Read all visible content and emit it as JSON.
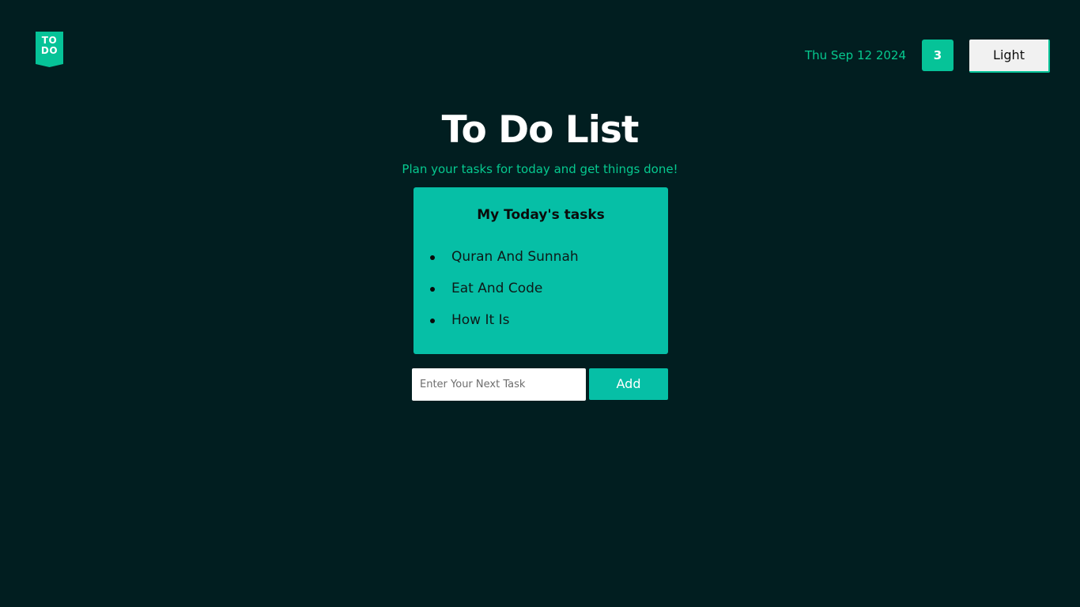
{
  "logo": {
    "line1": "TO",
    "line2": "DO",
    "color": "#06c398"
  },
  "header": {
    "date": "Thu Sep 12 2024",
    "task_count": "3",
    "theme_toggle_label": "Light"
  },
  "main": {
    "title": "To Do List",
    "subtitle": "Plan your tasks for today and get things done!"
  },
  "task_card": {
    "heading": "My Today's tasks",
    "tasks": [
      {
        "label": "Quran And Sunnah"
      },
      {
        "label": "Eat And Code"
      },
      {
        "label": "How It Is"
      }
    ]
  },
  "add_form": {
    "input_value": "",
    "input_placeholder": "Enter Your Next Task",
    "add_label": "Add"
  },
  "colors": {
    "background": "#011e20",
    "accent": "#06c398",
    "accent_text": "#06c98f",
    "card": "#06bfa6"
  }
}
